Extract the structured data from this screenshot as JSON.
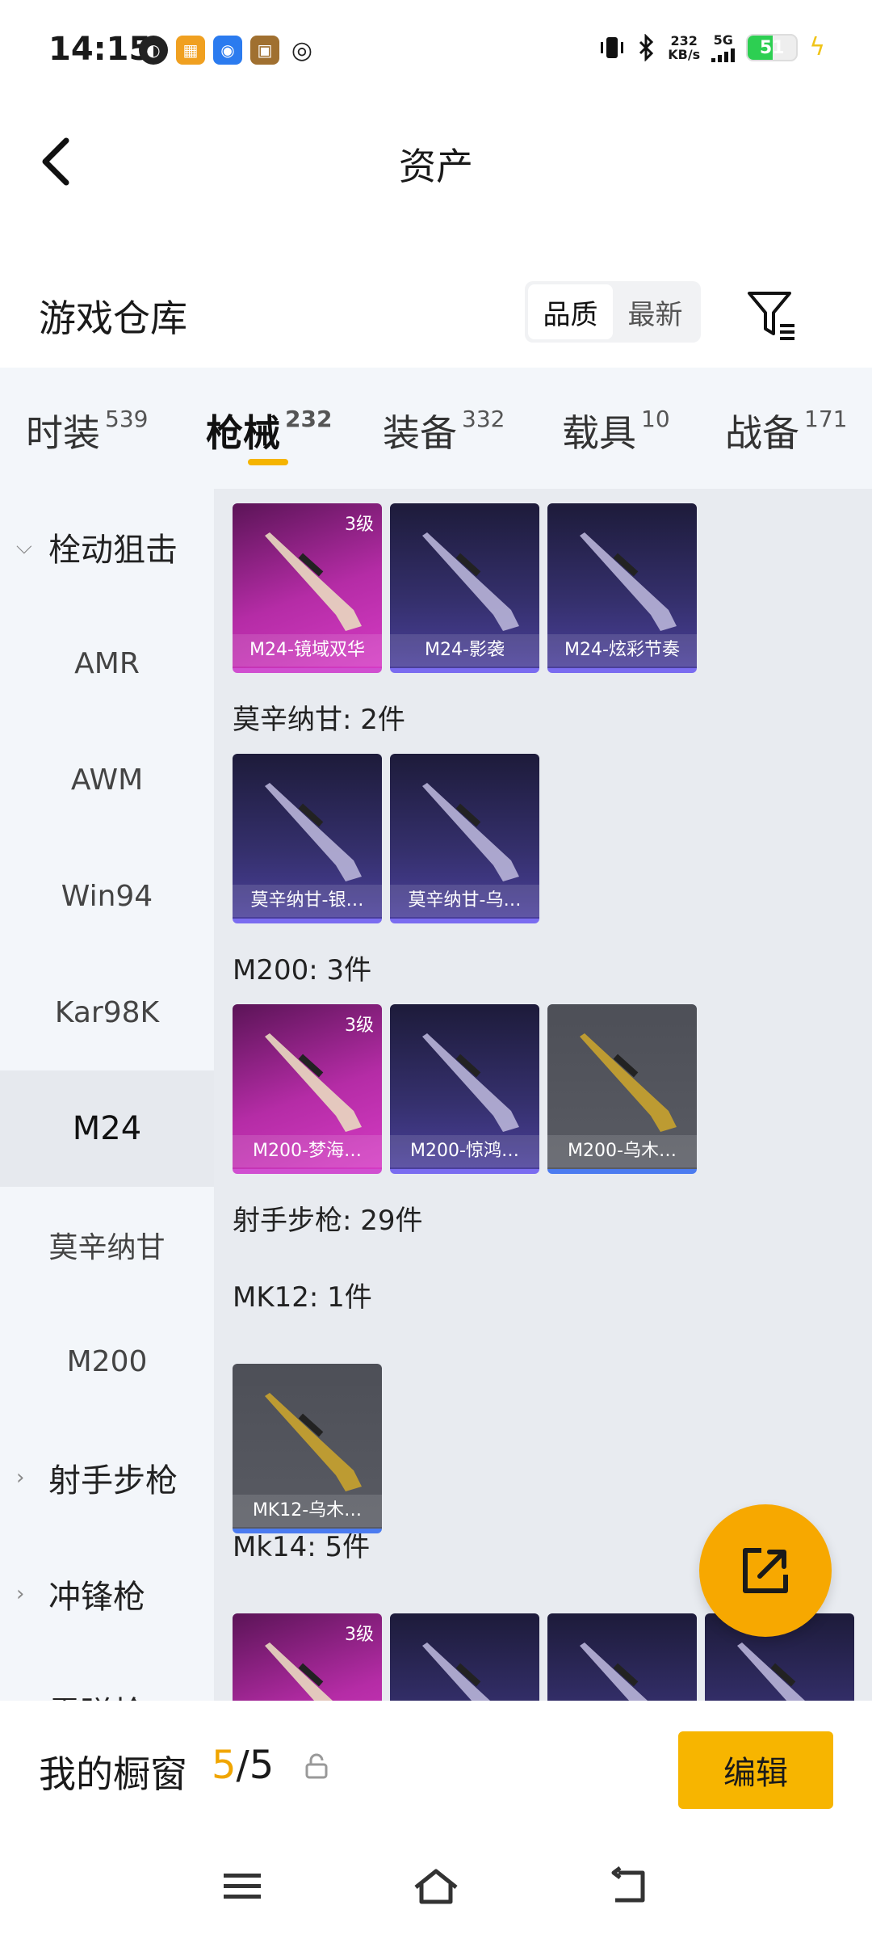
{
  "status": {
    "time": "14:15",
    "net_speed": "232",
    "net_unit": "KB/s",
    "network": "5G",
    "battery": "51",
    "battery_level": 0.51
  },
  "header": {
    "title": "资产"
  },
  "warehouse": {
    "title": "游戏仓库",
    "sort_options": [
      "品质",
      "最新"
    ],
    "active_sort": "品质"
  },
  "tabs": [
    {
      "label": "时装",
      "count": "539"
    },
    {
      "label": "枪械",
      "count": "232",
      "active": true
    },
    {
      "label": "装备",
      "count": "332"
    },
    {
      "label": "载具",
      "count": "10"
    },
    {
      "label": "战备",
      "count": "171"
    }
  ],
  "sidebar": [
    {
      "label": "栓动狙击",
      "group": true,
      "expanded": true
    },
    {
      "label": "AMR"
    },
    {
      "label": "AWM"
    },
    {
      "label": "Win94"
    },
    {
      "label": "Kar98K"
    },
    {
      "label": "M24",
      "active": true
    },
    {
      "label": "莫辛纳甘"
    },
    {
      "label": "M200"
    },
    {
      "label": "射手步枪",
      "group": true
    },
    {
      "label": "冲锋枪",
      "group": true
    },
    {
      "label": "霰弹枪",
      "group": true
    }
  ],
  "sections": [
    {
      "label": "",
      "items": [
        {
          "name": "M24-镜域双华",
          "tier": "pink",
          "level": "3级"
        },
        {
          "name": "M24-影袭",
          "tier": "purple"
        },
        {
          "name": "M24-炫彩节奏",
          "tier": "purple"
        }
      ]
    },
    {
      "label": "莫辛纳甘: 2件",
      "items": [
        {
          "name": "莫辛纳甘-银…",
          "tier": "purple"
        },
        {
          "name": "莫辛纳甘-乌…",
          "tier": "purple"
        }
      ]
    },
    {
      "label": "M200: 3件",
      "items": [
        {
          "name": "M200-梦海…",
          "tier": "pink",
          "level": "3级"
        },
        {
          "name": "M200-惊鸿…",
          "tier": "purple"
        },
        {
          "name": "M200-乌木…",
          "tier": "gray"
        }
      ]
    },
    {
      "label": "射手步枪: 29件",
      "items": []
    },
    {
      "label": "MK12: 1件",
      "items": [
        {
          "name": "MK12-乌木…",
          "tier": "gray"
        }
      ]
    },
    {
      "label": "Mk14: 5件",
      "items": [
        {
          "name": "",
          "tier": "pink",
          "level": "3级"
        },
        {
          "name": "",
          "tier": "purple"
        },
        {
          "name": "",
          "tier": "purple"
        },
        {
          "name": "",
          "tier": "purple"
        }
      ]
    }
  ],
  "showcase": {
    "label": "我的橱窗",
    "used": "5",
    "total": "/5",
    "edit_label": "编辑"
  },
  "colors": {
    "accent": "#f7b500",
    "pink_tier": "#b52ca6",
    "purple_tier": "#35306d",
    "gray_tier": "#595b63"
  },
  "icons": {
    "back": "chevron-left-icon",
    "filter": "filter-icon",
    "fab": "share-icon",
    "lock": "lock-icon",
    "nav": [
      "menu-icon",
      "home-icon",
      "back-nav-icon"
    ]
  }
}
